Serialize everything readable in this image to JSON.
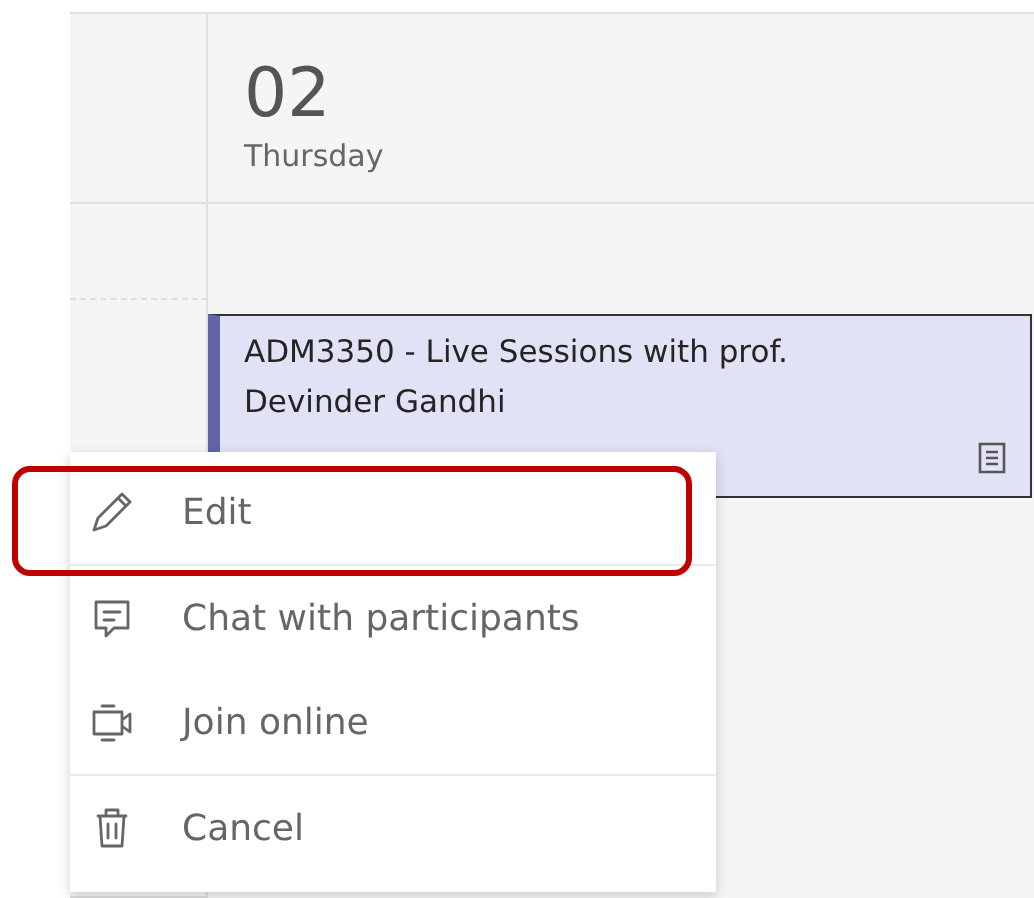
{
  "day": {
    "date": "02",
    "weekday": "Thursday"
  },
  "event": {
    "title": "ADM3350 - Live Sessions with prof. Devinder Gandhi"
  },
  "context_menu": {
    "items": [
      {
        "kind": "edit",
        "label": "Edit",
        "highlighted": true
      },
      {
        "kind": "chat",
        "label": "Chat with participants",
        "highlighted": false
      },
      {
        "kind": "join",
        "label": "Join online",
        "highlighted": false
      },
      {
        "kind": "cancel",
        "label": "Cancel",
        "highlighted": false
      }
    ]
  }
}
